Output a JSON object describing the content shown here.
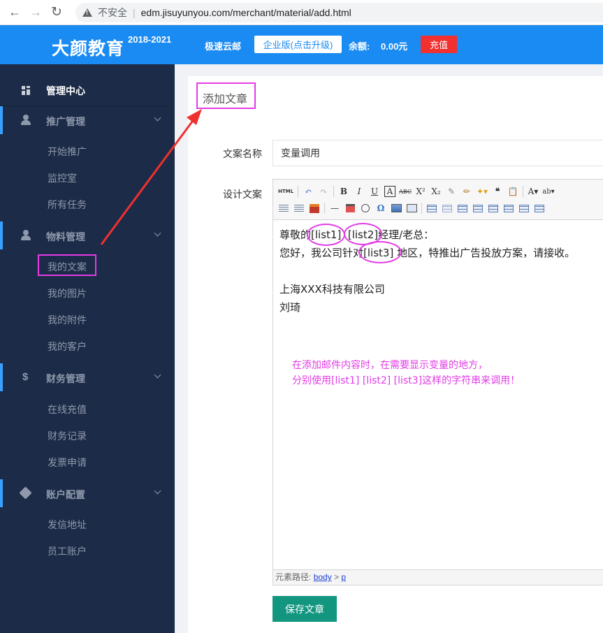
{
  "browser": {
    "security_label": "不安全",
    "url": "edm.jisuyunyou.com/merchant/material/add.html"
  },
  "header": {
    "logo": "大颜教育",
    "years": "2018-2021",
    "service_name": "极速云邮",
    "upgrade_label": "企业版(点击升级)",
    "balance_label": "余额:",
    "balance_value": "0.00元",
    "recharge_label": "充值",
    "colors": {
      "header_bg": "#1a8bf2",
      "recharge_bg": "#f23030"
    }
  },
  "sidebar": {
    "home": "管理中心",
    "groups": [
      {
        "label": "推广管理",
        "icon": "user-icon",
        "items": [
          "开始推广",
          "监控室",
          "所有任务"
        ]
      },
      {
        "label": "物料管理",
        "icon": "user-icon",
        "items": [
          "我的文案",
          "我的图片",
          "我的附件",
          "我的客户"
        ]
      },
      {
        "label": "财务管理",
        "icon": "dollar-icon",
        "items": [
          "在线充值",
          "财务记录",
          "发票申请"
        ]
      },
      {
        "label": "账户配置",
        "icon": "tag-icon",
        "items": [
          "发信地址",
          "员工账户"
        ]
      }
    ],
    "highlighted_item": "我的文案",
    "colors": {
      "bg": "#1c2b47",
      "highlight": "#e23ce6"
    }
  },
  "main": {
    "page_title": "添加文章",
    "name_label": "文案名称",
    "name_value": "变量调用",
    "design_label": "设计文案",
    "editor": {
      "content": {
        "line1_pre": "尊敬的",
        "var1": "[list1]",
        "var2": "[list2]",
        "line1_post": "经理/老总：",
        "line2_pre": "您好，我公司针对",
        "var3": "[list3]",
        "line2_post": "地区，特推出广告投放方案，请接收。",
        "company": "上海XXX科技有限公司",
        "signer": "刘琦"
      },
      "annotation": {
        "line1": "在添加邮件内容时，在需要显示变量的地方，",
        "line2": "分别使用[list1] [list2] [list3]这样的字符串来调用！"
      },
      "path_label": "元素路径:",
      "path_body": "body",
      "path_sep": ">",
      "path_p": "p",
      "toolbar_row1": [
        "html-icon",
        "undo-icon",
        "redo-icon",
        "bold-icon",
        "italic-icon",
        "underline-icon",
        "fontborder-icon",
        "strikethrough-icon",
        "superscript-icon",
        "subscript-icon",
        "eraser-icon",
        "formatbrush-icon",
        "autotypeset-icon",
        "blockquote-icon",
        "pasteplain-icon",
        "forecolor-icon",
        "backcolor-icon"
      ],
      "toolbar_row2": [
        "lineheight-icon",
        "rowspacing-icon",
        "insertimage-icon",
        "horizontal-icon",
        "date-icon",
        "time-icon",
        "specialchars-icon",
        "attachment-icon",
        "snapscreen-icon",
        "inserttable-icon",
        "deletetable-icon",
        "insertrow-icon",
        "deleterow-icon",
        "insertcol-icon",
        "deletecol-icon",
        "mergecells-icon",
        "splitcells-icon"
      ]
    },
    "save_label": "保存文章",
    "colors": {
      "save_bg": "#139680",
      "annotation": "#e23ce6"
    }
  }
}
